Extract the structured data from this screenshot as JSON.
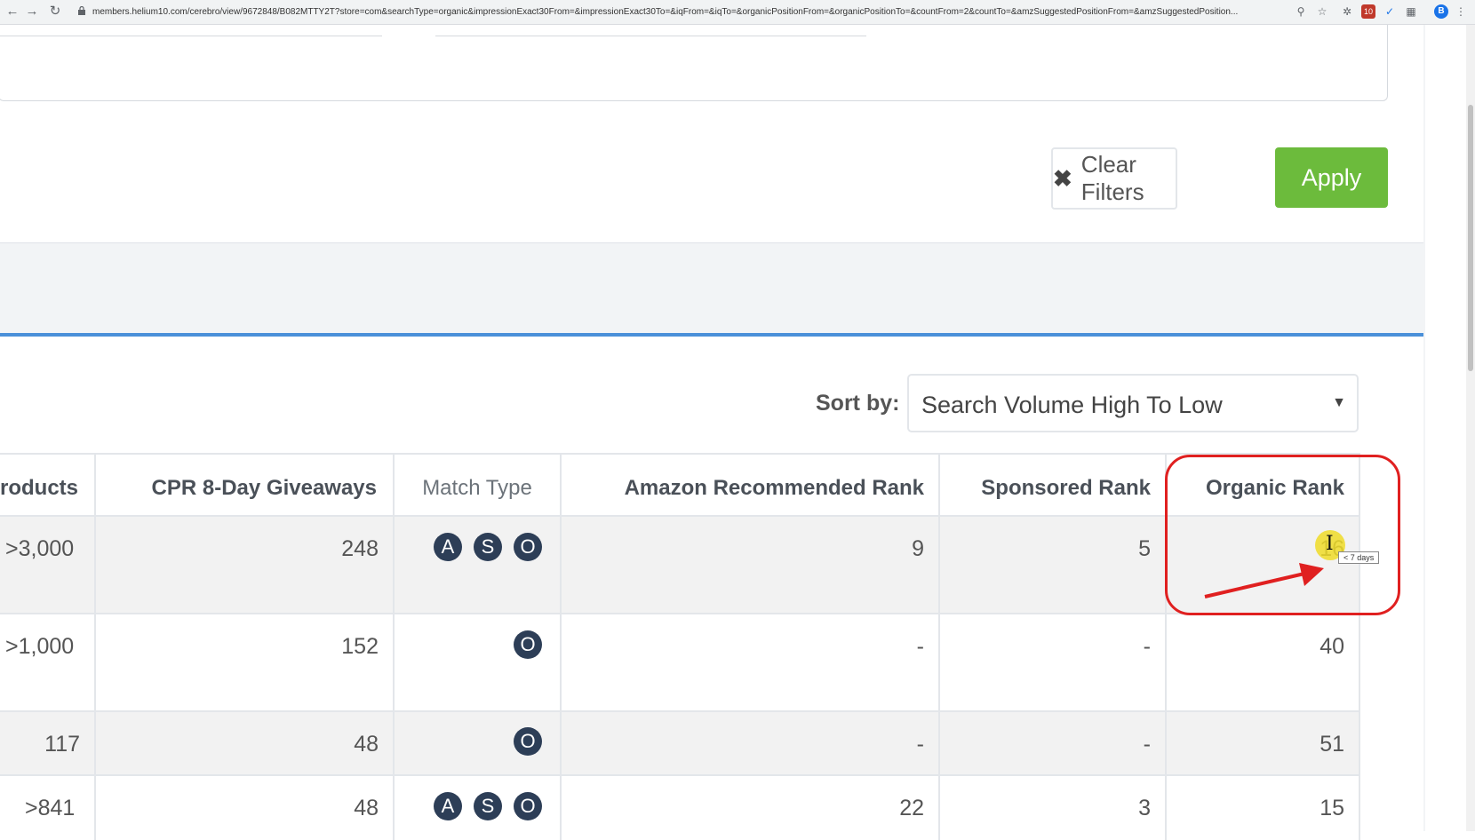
{
  "browser": {
    "url": "members.helium10.com/cerebro/view/9672848/B082MTTY2T?store=com&searchType=organic&impressionExact30From=&impressionExact30To=&iqFrom=&iqTo=&organicPositionFrom=&organicPositionTo=&countFrom=2&countTo=&amzSuggestedPositionFrom=&amzSuggestedPosition...",
    "profile_initial": "B",
    "extension_badge": "10"
  },
  "filters": {
    "clear_label": "Clear Filters",
    "apply_label": "Apply",
    "apply_color": "#6cbb3c"
  },
  "sort": {
    "label": "Sort by:",
    "selected": "Search Volume High To Low"
  },
  "table": {
    "headers": {
      "products": "roducts",
      "cpr": "CPR 8-Day Giveaways",
      "match": "Match Type",
      "amazon": "Amazon Recommended Rank",
      "sponsored": "Sponsored Rank",
      "organic": "Organic Rank"
    },
    "rows": [
      {
        "products": ">3,000",
        "cpr": "248",
        "match": [
          "A",
          "S",
          "O"
        ],
        "amazon": "9",
        "sponsored": "5",
        "organic": "16"
      },
      {
        "products": ">1,000",
        "cpr": "152",
        "match": [
          "O"
        ],
        "amazon": "-",
        "sponsored": "-",
        "organic": "40"
      },
      {
        "products": "117",
        "cpr": "48",
        "match": [
          "O"
        ],
        "amazon": "-",
        "sponsored": "-",
        "organic": "51"
      },
      {
        "products": ">841",
        "cpr": "48",
        "match": [
          "A",
          "S",
          "O"
        ],
        "amazon": "22",
        "sponsored": "3",
        "organic": "15"
      }
    ]
  },
  "tooltip": "< 7 days",
  "accent_colors": {
    "annotation": "#e02020",
    "tab_line": "#4a90d9",
    "badge": "#2d3e57"
  }
}
